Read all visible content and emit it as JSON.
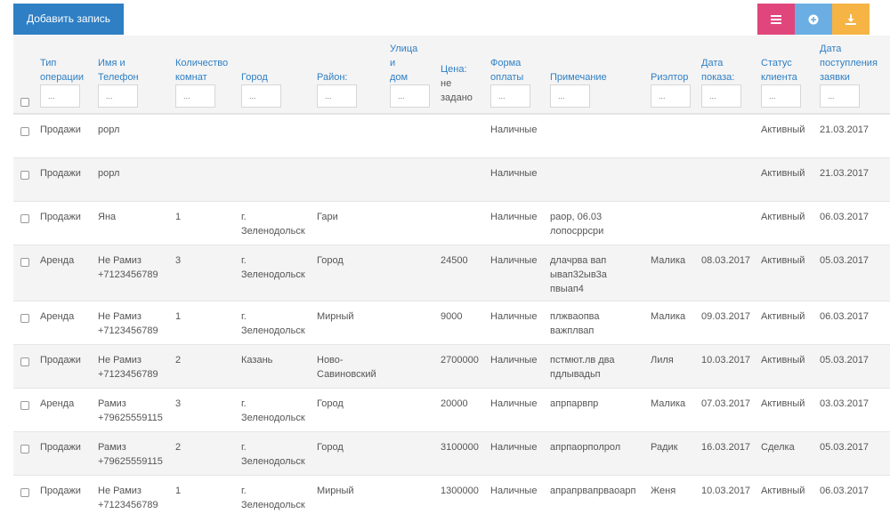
{
  "toolbar": {
    "add_label": "Добавить запись",
    "menu_icon": "list-icon",
    "add_icon": "plus-circle-icon",
    "download_icon": "download-icon"
  },
  "columns": [
    {
      "label": "Тип\nоперации",
      "placeholder": "...",
      "filter": true
    },
    {
      "label": "Имя и\nТелефон",
      "placeholder": "...",
      "filter": true
    },
    {
      "label": "Количество\nкомнат",
      "placeholder": "...",
      "filter": true
    },
    {
      "label": "Город",
      "placeholder": "...",
      "filter": true
    },
    {
      "label": "Район:",
      "placeholder": "...",
      "filter": true
    },
    {
      "label": "Улица и\nдом",
      "placeholder": "...",
      "filter": true
    },
    {
      "label": "Цена:",
      "extra": "не\nзадано",
      "filter": false
    },
    {
      "label": "Форма\nоплаты",
      "placeholder": "...",
      "filter": true
    },
    {
      "label": "Примечание",
      "placeholder": "...",
      "filter": true
    },
    {
      "label": "Риэлтор",
      "placeholder": "...",
      "filter": true
    },
    {
      "label": "Дата\nпоказа:",
      "placeholder": "...",
      "filter": true
    },
    {
      "label": "Статус\nклиента",
      "placeholder": "...",
      "filter": true
    },
    {
      "label": "Дата\nпоступления\nзаявки",
      "placeholder": "...",
      "filter": true
    }
  ],
  "rows": [
    [
      "Продажи",
      "рорл",
      "",
      "",
      "",
      "",
      "",
      "Наличные",
      "",
      "",
      "",
      "Активный",
      "21.03.2017"
    ],
    [
      "Продажи",
      "рорл",
      "",
      "",
      "",
      "",
      "",
      "Наличные",
      "",
      "",
      "",
      "Активный",
      "21.03.2017"
    ],
    [
      "Продажи",
      "Яна",
      "1",
      "г.\nЗеленодольск",
      "Гари",
      "",
      "",
      "Наличные",
      "раор, 06.03\nлопосррсри",
      "",
      "",
      "Активный",
      "06.03.2017"
    ],
    [
      "Аренда",
      "Не Рамиз\n+7123456789",
      "3",
      "г.\nЗеленодольск",
      "Город",
      "",
      "24500",
      "Наличные",
      "длачрва вап\nывап32ыв3а\nпвыап4",
      "Малика",
      "08.03.2017",
      "Активный",
      "05.03.2017"
    ],
    [
      "Аренда",
      "Не Рамиз\n+7123456789",
      "1",
      "г.\nЗеленодольск",
      "Мирный",
      "",
      "9000",
      "Наличные",
      "плжваопва\nважплвап",
      "Малика",
      "09.03.2017",
      "Активный",
      "06.03.2017"
    ],
    [
      "Продажи",
      "Не Рамиз\n+7123456789",
      "2",
      "Казань",
      "Ново-\nСавиновский",
      "",
      "2700000",
      "Наличные",
      "пстмют.лв два\nпдлывадьп",
      "Лиля",
      "10.03.2017",
      "Активный",
      "05.03.2017"
    ],
    [
      "Аренда",
      "Рамиз\n+79625559115",
      "3",
      "г.\nЗеленодольск",
      "Город",
      "",
      "20000",
      "Наличные",
      "апрпарвпр",
      "Малика",
      "07.03.2017",
      "Активный",
      "03.03.2017"
    ],
    [
      "Продажи",
      "Рамиз\n+79625559115",
      "2",
      "г.\nЗеленодольск",
      "Город",
      "",
      "3100000",
      "Наличные",
      "апрпаорполрол",
      "Радик",
      "16.03.2017",
      "Сделка",
      "05.03.2017"
    ],
    [
      "Продажи",
      "Не Рамиз\n+7123456789",
      "1",
      "г.\nЗеленодольск",
      "Мирный",
      "",
      "1300000",
      "Наличные",
      "апрапрвапрваоарп",
      "Женя",
      "10.03.2017",
      "Активный",
      "06.03.2017"
    ]
  ]
}
